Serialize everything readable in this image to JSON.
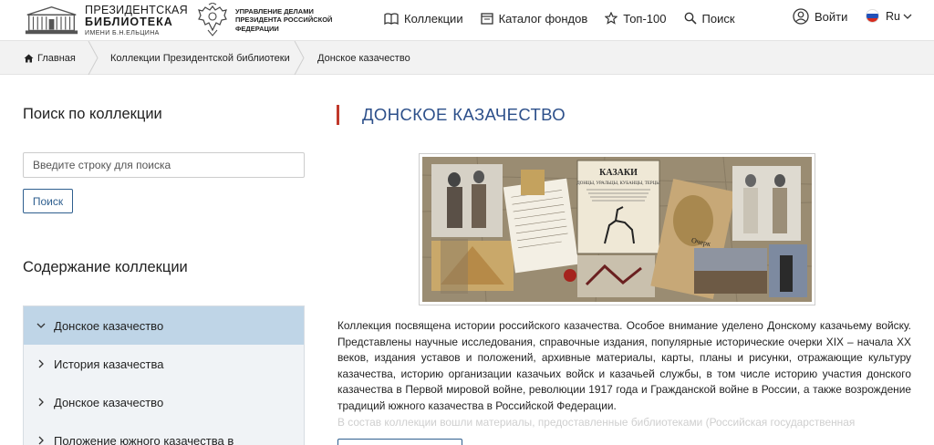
{
  "header": {
    "logo_line1": "ПРЕЗИДЕНТСКАЯ",
    "logo_line2": "БИБЛИОТЕКА",
    "logo_line3": "ИМЕНИ Б.Н.ЕЛЬЦИНА",
    "emblem_text": "УПРАВЛЕНИЕ ДЕЛАМИ ПРЕЗИДЕНТА РОССИЙСКОЙ ФЕДЕРАЦИИ",
    "nav": [
      {
        "label": "Коллекции",
        "icon": "book-icon"
      },
      {
        "label": "Каталог фондов",
        "icon": "catalog-icon"
      },
      {
        "label": "Топ-100",
        "icon": "star-icon"
      },
      {
        "label": "Поиск",
        "icon": "search-icon"
      }
    ],
    "login_label": "Войти",
    "lang_label": "Ru"
  },
  "breadcrumb": {
    "home": "Главная",
    "collections": "Коллекции Президентской библиотеки",
    "current": "Донское казачество"
  },
  "sidebar": {
    "search_title": "Поиск по коллекции",
    "search_placeholder": "Введите строку для поиска",
    "search_button": "Поиск",
    "toc_title": "Содержание коллекции",
    "toc_items": [
      {
        "label": "Донское казачество"
      },
      {
        "label": "История казачества"
      },
      {
        "label": "Донское казачество"
      },
      {
        "label": "Положение южного казачества в"
      }
    ]
  },
  "main": {
    "title": "ДОНСКОЕ КАЗАЧЕСТВО",
    "collage_card_title": "КАЗАКИ",
    "collage_card_subtitle": "ДОНЦЫ, УРАЛЬЦЫ, КУБАНЦЫ, ТЕРЦЫ",
    "collage_book_title": "Очерк",
    "description": "Коллекция посвящена истории российского казачества. Особое внимание уделено Донскому казачьему войску. Представлены научные исследования, справочные издания, популярные исторические очерки XIX – начала XX веков, издания уставов и положений, архивные материалы, карты, планы и рисунки, отражающие культуру казачества, историю организации казачьих войск и казачьей службы, в том числе историю участия донского казачества в Первой мировой войне, революции 1917 года и Гражданской войне в России, а также возрождение традиций южного казачества в Российской Федерации.",
    "description_fade": "В состав коллекции вошли материалы, предоставленные библиотеками (Российская государственная"
  },
  "colors": {
    "accent_red": "#c0392b",
    "title_blue": "#2c4f8a",
    "active_item": "#bfd5e7",
    "button_border": "#2f5f8f"
  }
}
